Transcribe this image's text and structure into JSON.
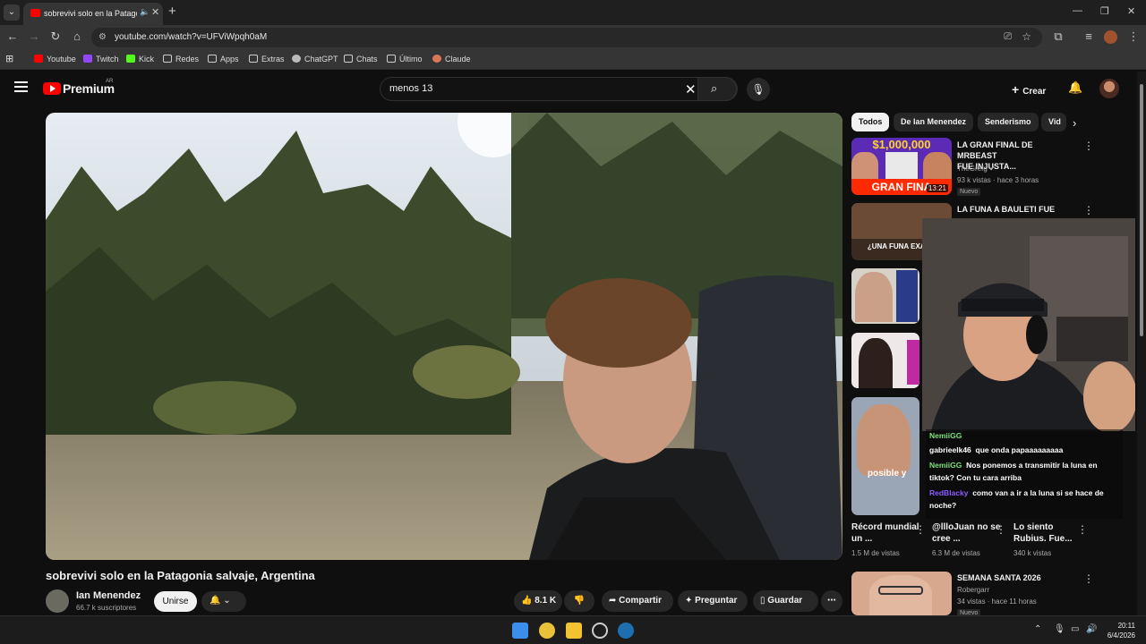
{
  "browser": {
    "tab_title": "sobrevivi solo en la Patagonia salvaje, Argentina",
    "url": "youtube.com/watch?v=UFViWpqh0aM",
    "bookmarks": [
      "Youtube",
      "Twitch",
      "Kick",
      "Redes",
      "Apps",
      "Extras",
      "ChatGPT",
      "Chats",
      "Último",
      "Claude"
    ]
  },
  "header": {
    "brand": "Premium",
    "region": "AR",
    "search_query": "menos 13",
    "create_label": "Crear"
  },
  "video": {
    "title": "sobrevivi solo en la Patagonia salvaje, Argentina",
    "channel": "Ian Menendez",
    "subscribers": "66.7 k suscriptores",
    "join_label": "Unirse",
    "likes": "8.1 K",
    "share_label": "Compartir",
    "ask_label": "Preguntar",
    "save_label": "Guardar"
  },
  "sidebar": {
    "chips": [
      "Todos",
      "De Ian Menendez",
      "Senderismo",
      "Vid"
    ],
    "items": [
      {
        "title_line1": "LA GRAN FINAL DE MRBEAST",
        "title_line2": "FUE INJUSTA...",
        "channel": "TheGrefg",
        "meta": "93 k vistas · hace 3 horas",
        "badge": "Nuevo",
        "duration": "13:21",
        "thumb_text": "GRAN FINA",
        "thumb_money": "$1,000,000"
      },
      {
        "title_line1": "LA FUNA A BAULETI FUE",
        "thumb_text": "¿UNA FUNA EXAGE"
      },
      {
        "title_line1": "SEMANA SANTA 2026",
        "channel": "Robergarr",
        "meta": "34 vistas · hace 11 horas",
        "badge": "Nuevo"
      }
    ],
    "shorts": [
      {
        "title": "Récord mundial un ...",
        "views": "1.5 M de vistas"
      },
      {
        "title": "@llloJuan no se cree ...",
        "views": "6.3 M de vistas"
      },
      {
        "title": "Lo siento Rubius. Fue...",
        "views": "340 k vistas"
      }
    ],
    "short_caption": "posible y"
  },
  "stream_chat": [
    {
      "user": "NemiiGG",
      "text": ""
    },
    {
      "user": "gabrieelk46",
      "text": "que onda papaaaaaaaaa"
    },
    {
      "user": "NemiiGG",
      "text": "Nos ponemos a transmitir la luna en tiktok? Con tu cara arriba"
    },
    {
      "user": "RedBlacky",
      "text": "como van a ir a la luna si se hace de noche?"
    }
  ],
  "taskbar": {
    "time": "20:11",
    "date": "6/4/2026"
  },
  "colors": {
    "brand_red": "#ff0000",
    "background": "#0f0f0f",
    "chip_active": "#f1f1f1",
    "chat_user_green": "#7ee07a",
    "chat_user_purple": "#8a5cff"
  }
}
